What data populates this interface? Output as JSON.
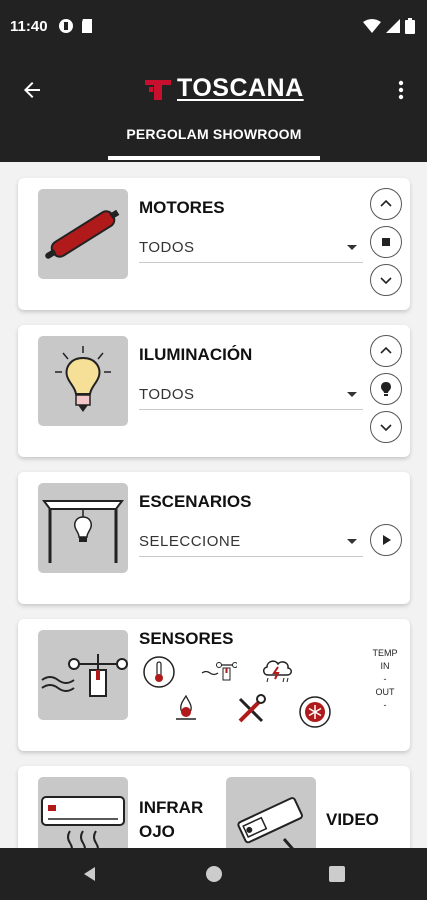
{
  "status": {
    "time": "11:40"
  },
  "appbar": {
    "brand": "TOSCANA",
    "tab": "PERGOLAM SHOWROOM"
  },
  "motores": {
    "title": "MOTORES",
    "dropdown_value": "TODOS"
  },
  "iluminacion": {
    "title": "ILUMINACIÓN",
    "dropdown_value": "TODOS"
  },
  "escenarios": {
    "title": "ESCENARIOS",
    "dropdown_value": "SELECCIONE"
  },
  "sensores": {
    "title": "SENSORES",
    "temp_label": "TEMP",
    "in_label": "IN",
    "dash1": "-",
    "out_label": "OUT",
    "dash2": "-"
  },
  "bottom_card": {
    "infra_line1": "INFRAR",
    "infra_line2": "OJO",
    "video_label": "VIDEO"
  },
  "colors": {
    "bar": "#222222",
    "brand_red": "#c8102e",
    "card_bg": "#ffffff",
    "thumb_bg": "#c8c8c8"
  },
  "icons": [
    "back-arrow-icon",
    "more-vert-icon",
    "chevron-up-icon",
    "stop-icon",
    "chevron-down-icon",
    "bulb-icon",
    "play-icon"
  ]
}
